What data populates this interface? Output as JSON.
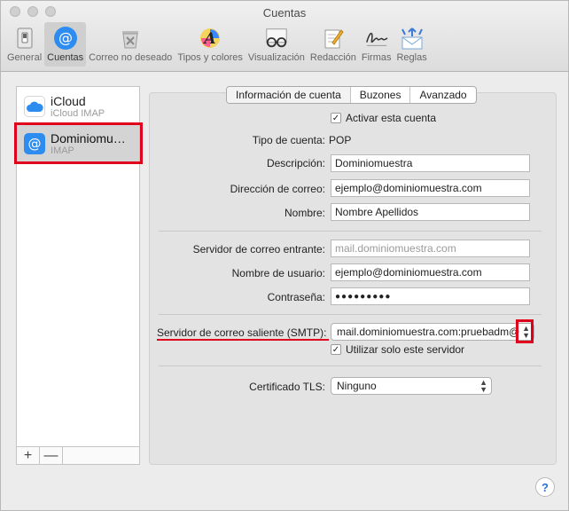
{
  "window": {
    "title": "Cuentas"
  },
  "toolbar": {
    "items": [
      {
        "label": "General",
        "icon": "general-switch-icon"
      },
      {
        "label": "Cuentas",
        "icon": "at-sign-icon"
      },
      {
        "label": "Correo no deseado",
        "icon": "trash-junk-icon"
      },
      {
        "label": "Tipos y colores",
        "icon": "font-a-icon"
      },
      {
        "label": "Visualización",
        "icon": "glasses-icon"
      },
      {
        "label": "Redacción",
        "icon": "pencil-paper-icon"
      },
      {
        "label": "Firmas",
        "icon": "signature-icon"
      },
      {
        "label": "Reglas",
        "icon": "rules-envelope-icon"
      }
    ],
    "active_index": 1
  },
  "accounts": [
    {
      "name": "iCloud",
      "type": "iCloud IMAP",
      "icon": "cloud-icon"
    },
    {
      "name": "Dominiomu…",
      "type": "IMAP",
      "icon": "at-sign-icon"
    }
  ],
  "list_footer": {
    "add": "+",
    "remove": "—"
  },
  "tabs": [
    "Información de cuenta",
    "Buzones",
    "Avanzado"
  ],
  "form": {
    "enable_account_label": "Activar esta cuenta",
    "account_type_label": "Tipo de cuenta:",
    "account_type_value": "POP",
    "description_label": "Descripción:",
    "description_value": "Dominiomuestra",
    "email_label": "Dirección de correo:",
    "email_value": "ejemplo@dominiomuestra.com",
    "name_label": "Nombre:",
    "name_value": "Nombre Apellidos",
    "incoming_label": "Servidor de correo entrante:",
    "incoming_placeholder": "mail.dominiomuestra.com",
    "username_label": "Nombre de usuario:",
    "username_value": "ejemplo@dominiomuestra.com",
    "password_label": "Contraseña:",
    "password_value": "●●●●●●●●●",
    "smtp_label": "Servidor de correo saliente (SMTP):",
    "smtp_value": "mail.dominiomuestra.com:pruebadm@",
    "only_server_label": "Utilizar solo este servidor",
    "tls_label": "Certificado TLS:",
    "tls_value": "Ninguno"
  },
  "help": "?"
}
